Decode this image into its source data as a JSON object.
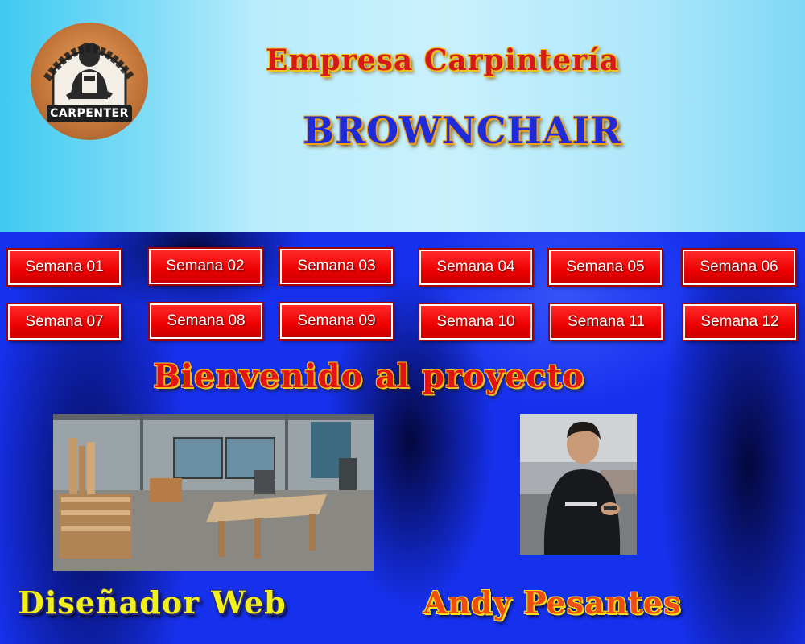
{
  "header": {
    "logo_text": "CARPENTER",
    "company_line": "Empresa Carpintería",
    "brand_name": "BROWNCHAIR"
  },
  "nav": {
    "weeks": [
      "Semana 01",
      "Semana 02",
      "Semana 03",
      "Semana 04",
      "Semana 05",
      "Semana 06",
      "Semana 07",
      "Semana 08",
      "Semana 09",
      "Semana 10",
      "Semana 11",
      "Semana 12"
    ]
  },
  "main": {
    "welcome": "Bienvenido al proyecto",
    "role": "Diseñador Web",
    "author": "Andy Pesantes"
  },
  "colors": {
    "header_bg": "#bfeefb",
    "main_bg": "#1631ee",
    "button_red": "#ee0000",
    "title_red": "#d41a1a",
    "brand_blue": "#1f2bd6",
    "role_yellow": "#f2f01a",
    "author_orange": "#ee4d12"
  },
  "icons": {
    "logo": "carpenter-logo-icon"
  }
}
